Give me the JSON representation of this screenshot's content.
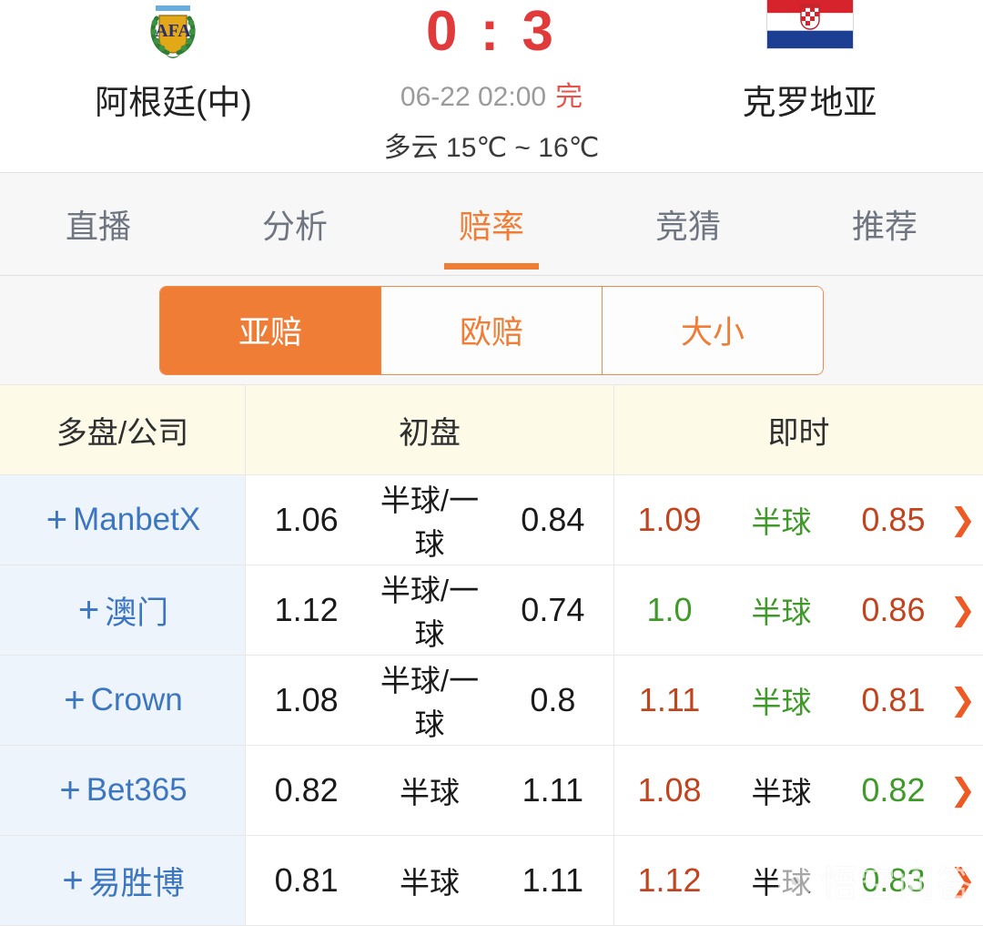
{
  "match": {
    "home": {
      "name": "阿根廷(中)",
      "crest": "afa-crest-icon"
    },
    "away": {
      "name": "克罗地亚",
      "crest": "croatia-flag-icon"
    },
    "score": "0 : 3",
    "datetime": "06-22 02:00",
    "status": "完",
    "weather": "多云  15℃ ~ 16℃"
  },
  "tabs": [
    {
      "label": "直播",
      "active": false
    },
    {
      "label": "分析",
      "active": false
    },
    {
      "label": "赔率",
      "active": true
    },
    {
      "label": "竞猜",
      "active": false
    },
    {
      "label": "推荐",
      "active": false
    }
  ],
  "segments": [
    {
      "label": "亚赔",
      "active": true
    },
    {
      "label": "欧赔",
      "active": false
    },
    {
      "label": "大小",
      "active": false
    }
  ],
  "table": {
    "headers": [
      "多盘/公司",
      "初盘",
      "即时"
    ],
    "rows": [
      {
        "company": "ManbetX",
        "open": {
          "home": "1.06",
          "handicap": "半球/一球",
          "away": "0.84"
        },
        "live": {
          "home": "1.09",
          "home_color": "red",
          "handicap": "半球",
          "handicap_color": "green",
          "away": "0.85",
          "away_color": "red"
        }
      },
      {
        "company": "澳门",
        "open": {
          "home": "1.12",
          "handicap": "半球/一球",
          "away": "0.74"
        },
        "live": {
          "home": "1.0",
          "home_color": "green",
          "handicap": "半球",
          "handicap_color": "green",
          "away": "0.86",
          "away_color": "red"
        }
      },
      {
        "company": "Crown",
        "open": {
          "home": "1.08",
          "handicap": "半球/一球",
          "away": "0.8"
        },
        "live": {
          "home": "1.11",
          "home_color": "red",
          "handicap": "半球",
          "handicap_color": "green",
          "away": "0.81",
          "away_color": "red"
        }
      },
      {
        "company": "Bet365",
        "open": {
          "home": "0.82",
          "handicap": "半球",
          "away": "1.11"
        },
        "live": {
          "home": "1.08",
          "home_color": "red",
          "handicap": "半球",
          "handicap_color": "black",
          "away": "0.82",
          "away_color": "green"
        }
      },
      {
        "company": "易胜博",
        "open": {
          "home": "0.81",
          "handicap": "半球",
          "away": "1.11"
        },
        "live": {
          "home": "1.12",
          "home_color": "red",
          "handicap": "半球",
          "handicap_color": "black",
          "away": "0.83",
          "away_color": "green"
        }
      }
    ],
    "expand_icon": "plus-icon",
    "detail_icon": "chevron-right-icon"
  },
  "watermark": {
    "text": "悟空问答"
  },
  "colors": {
    "accent": "#ef7d36",
    "score": "#e13a3a",
    "up": "#c1441e",
    "down": "#3f9a29",
    "link": "#3d76c0",
    "header_bg": "#fdfbe8",
    "company_bg": "#eef4fb"
  }
}
